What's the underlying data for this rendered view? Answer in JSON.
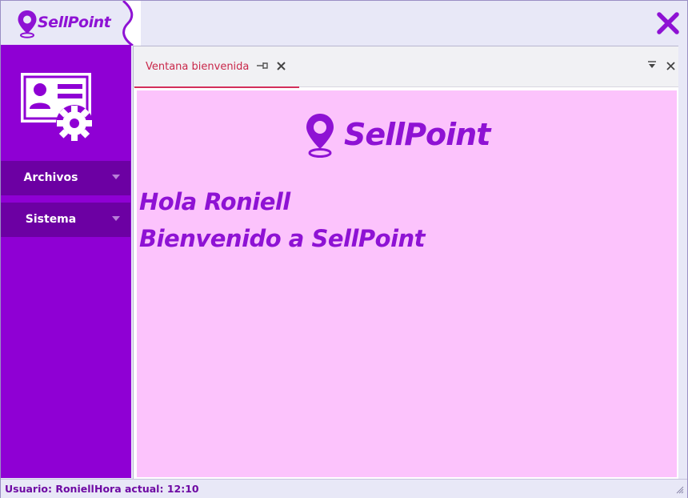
{
  "app": {
    "brand": "SellPoint",
    "colors": {
      "primary": "#8f00d4",
      "nav_button": "#6c00a3",
      "content_bg": "#fcc3fc",
      "tab_accent": "#d32f5a"
    }
  },
  "sidebar": {
    "items": [
      {
        "label": "Archivos",
        "icon": "chevron-down-icon"
      },
      {
        "label": "Sistema",
        "icon": "chevron-down-icon"
      }
    ]
  },
  "tabs": [
    {
      "label": "Ventana bienvenida",
      "active": true
    }
  ],
  "content": {
    "brand": "SellPoint",
    "greeting_line1": "Hola Roniell",
    "greeting_line2": "Bienvenido a SellPoint"
  },
  "status": {
    "user_label": "Usuario:",
    "user_name": "Roniell",
    "time_label": "Hora actual:",
    "time": "12:10"
  }
}
